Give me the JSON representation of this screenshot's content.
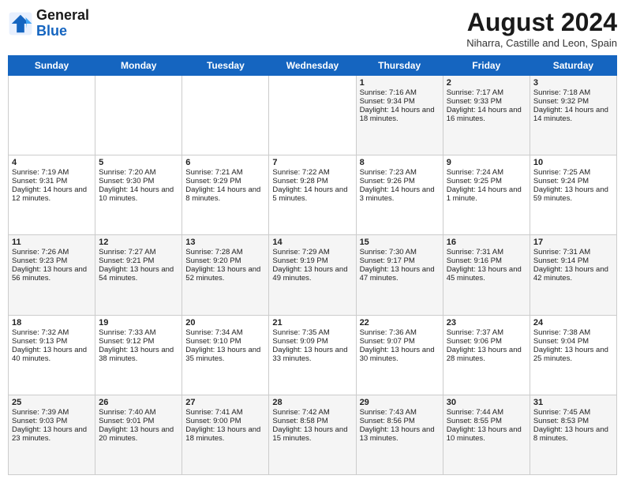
{
  "header": {
    "logo_line1": "General",
    "logo_line2": "Blue",
    "month_year": "August 2024",
    "location": "Niharra, Castille and Leon, Spain"
  },
  "days_of_week": [
    "Sunday",
    "Monday",
    "Tuesday",
    "Wednesday",
    "Thursday",
    "Friday",
    "Saturday"
  ],
  "weeks": [
    [
      {
        "day": "",
        "sunrise": "",
        "sunset": "",
        "daylight": ""
      },
      {
        "day": "",
        "sunrise": "",
        "sunset": "",
        "daylight": ""
      },
      {
        "day": "",
        "sunrise": "",
        "sunset": "",
        "daylight": ""
      },
      {
        "day": "",
        "sunrise": "",
        "sunset": "",
        "daylight": ""
      },
      {
        "day": "1",
        "sunrise": "Sunrise: 7:16 AM",
        "sunset": "Sunset: 9:34 PM",
        "daylight": "Daylight: 14 hours and 18 minutes."
      },
      {
        "day": "2",
        "sunrise": "Sunrise: 7:17 AM",
        "sunset": "Sunset: 9:33 PM",
        "daylight": "Daylight: 14 hours and 16 minutes."
      },
      {
        "day": "3",
        "sunrise": "Sunrise: 7:18 AM",
        "sunset": "Sunset: 9:32 PM",
        "daylight": "Daylight: 14 hours and 14 minutes."
      }
    ],
    [
      {
        "day": "4",
        "sunrise": "Sunrise: 7:19 AM",
        "sunset": "Sunset: 9:31 PM",
        "daylight": "Daylight: 14 hours and 12 minutes."
      },
      {
        "day": "5",
        "sunrise": "Sunrise: 7:20 AM",
        "sunset": "Sunset: 9:30 PM",
        "daylight": "Daylight: 14 hours and 10 minutes."
      },
      {
        "day": "6",
        "sunrise": "Sunrise: 7:21 AM",
        "sunset": "Sunset: 9:29 PM",
        "daylight": "Daylight: 14 hours and 8 minutes."
      },
      {
        "day": "7",
        "sunrise": "Sunrise: 7:22 AM",
        "sunset": "Sunset: 9:28 PM",
        "daylight": "Daylight: 14 hours and 5 minutes."
      },
      {
        "day": "8",
        "sunrise": "Sunrise: 7:23 AM",
        "sunset": "Sunset: 9:26 PM",
        "daylight": "Daylight: 14 hours and 3 minutes."
      },
      {
        "day": "9",
        "sunrise": "Sunrise: 7:24 AM",
        "sunset": "Sunset: 9:25 PM",
        "daylight": "Daylight: 14 hours and 1 minute."
      },
      {
        "day": "10",
        "sunrise": "Sunrise: 7:25 AM",
        "sunset": "Sunset: 9:24 PM",
        "daylight": "Daylight: 13 hours and 59 minutes."
      }
    ],
    [
      {
        "day": "11",
        "sunrise": "Sunrise: 7:26 AM",
        "sunset": "Sunset: 9:23 PM",
        "daylight": "Daylight: 13 hours and 56 minutes."
      },
      {
        "day": "12",
        "sunrise": "Sunrise: 7:27 AM",
        "sunset": "Sunset: 9:21 PM",
        "daylight": "Daylight: 13 hours and 54 minutes."
      },
      {
        "day": "13",
        "sunrise": "Sunrise: 7:28 AM",
        "sunset": "Sunset: 9:20 PM",
        "daylight": "Daylight: 13 hours and 52 minutes."
      },
      {
        "day": "14",
        "sunrise": "Sunrise: 7:29 AM",
        "sunset": "Sunset: 9:19 PM",
        "daylight": "Daylight: 13 hours and 49 minutes."
      },
      {
        "day": "15",
        "sunrise": "Sunrise: 7:30 AM",
        "sunset": "Sunset: 9:17 PM",
        "daylight": "Daylight: 13 hours and 47 minutes."
      },
      {
        "day": "16",
        "sunrise": "Sunrise: 7:31 AM",
        "sunset": "Sunset: 9:16 PM",
        "daylight": "Daylight: 13 hours and 45 minutes."
      },
      {
        "day": "17",
        "sunrise": "Sunrise: 7:31 AM",
        "sunset": "Sunset: 9:14 PM",
        "daylight": "Daylight: 13 hours and 42 minutes."
      }
    ],
    [
      {
        "day": "18",
        "sunrise": "Sunrise: 7:32 AM",
        "sunset": "Sunset: 9:13 PM",
        "daylight": "Daylight: 13 hours and 40 minutes."
      },
      {
        "day": "19",
        "sunrise": "Sunrise: 7:33 AM",
        "sunset": "Sunset: 9:12 PM",
        "daylight": "Daylight: 13 hours and 38 minutes."
      },
      {
        "day": "20",
        "sunrise": "Sunrise: 7:34 AM",
        "sunset": "Sunset: 9:10 PM",
        "daylight": "Daylight: 13 hours and 35 minutes."
      },
      {
        "day": "21",
        "sunrise": "Sunrise: 7:35 AM",
        "sunset": "Sunset: 9:09 PM",
        "daylight": "Daylight: 13 hours and 33 minutes."
      },
      {
        "day": "22",
        "sunrise": "Sunrise: 7:36 AM",
        "sunset": "Sunset: 9:07 PM",
        "daylight": "Daylight: 13 hours and 30 minutes."
      },
      {
        "day": "23",
        "sunrise": "Sunrise: 7:37 AM",
        "sunset": "Sunset: 9:06 PM",
        "daylight": "Daylight: 13 hours and 28 minutes."
      },
      {
        "day": "24",
        "sunrise": "Sunrise: 7:38 AM",
        "sunset": "Sunset: 9:04 PM",
        "daylight": "Daylight: 13 hours and 25 minutes."
      }
    ],
    [
      {
        "day": "25",
        "sunrise": "Sunrise: 7:39 AM",
        "sunset": "Sunset: 9:03 PM",
        "daylight": "Daylight: 13 hours and 23 minutes."
      },
      {
        "day": "26",
        "sunrise": "Sunrise: 7:40 AM",
        "sunset": "Sunset: 9:01 PM",
        "daylight": "Daylight: 13 hours and 20 minutes."
      },
      {
        "day": "27",
        "sunrise": "Sunrise: 7:41 AM",
        "sunset": "Sunset: 9:00 PM",
        "daylight": "Daylight: 13 hours and 18 minutes."
      },
      {
        "day": "28",
        "sunrise": "Sunrise: 7:42 AM",
        "sunset": "Sunset: 8:58 PM",
        "daylight": "Daylight: 13 hours and 15 minutes."
      },
      {
        "day": "29",
        "sunrise": "Sunrise: 7:43 AM",
        "sunset": "Sunset: 8:56 PM",
        "daylight": "Daylight: 13 hours and 13 minutes."
      },
      {
        "day": "30",
        "sunrise": "Sunrise: 7:44 AM",
        "sunset": "Sunset: 8:55 PM",
        "daylight": "Daylight: 13 hours and 10 minutes."
      },
      {
        "day": "31",
        "sunrise": "Sunrise: 7:45 AM",
        "sunset": "Sunset: 8:53 PM",
        "daylight": "Daylight: 13 hours and 8 minutes."
      }
    ]
  ]
}
